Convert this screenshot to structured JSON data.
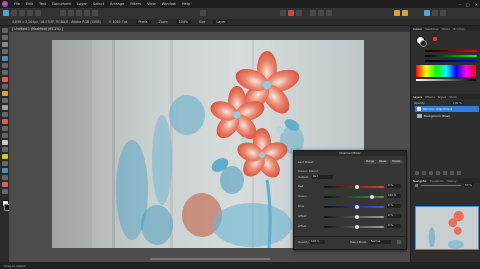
{
  "menu": {
    "items": [
      "File",
      "Edit",
      "Text",
      "Document",
      "Layer",
      "Select",
      "Arrange",
      "Filters",
      "View",
      "Window",
      "Help"
    ]
  },
  "window_controls": {
    "minimize": "–",
    "maximize": "□",
    "close": "✕"
  },
  "context_bar": {
    "info": "4,896 x 3,264px, 16.07MP, RGBA/8 - Adobe RGB (1998)",
    "cursor": "Y: 4069.7px",
    "units": "Pixels",
    "zoom_label": "Zoom",
    "zoom_value": "104%",
    "sample": "Size",
    "blend": "Layer"
  },
  "document": {
    "tab_title": "[ Untitled 1 (Modified) (85.2%) ]"
  },
  "right_panel": {
    "tabs_top": [
      "Colour",
      "Swatches",
      "Stroke",
      "Brushes"
    ],
    "tabs_mid": [
      "Layers",
      "Effects",
      "Styles",
      "Stock"
    ],
    "blend_label": "Opacity",
    "blend_value": "100 %",
    "layers": [
      {
        "name": "Recolour Adjustment",
        "type": "adjustment",
        "selected": true
      },
      {
        "name": "Background (Pixel)",
        "type": "pixel",
        "selected": false
      }
    ],
    "tabs_bottom": [
      "Navigator",
      "Transform",
      "History"
    ],
    "zoom_value": "83 %"
  },
  "dialog": {
    "title": "Channel Mixer",
    "preset_label": "Last Preset",
    "buttons": [
      "Merge",
      "Reset",
      "Delete"
    ],
    "colour_label": "Colour: Colour",
    "output_label": "Output",
    "output_value": "Red",
    "rows": [
      {
        "label": "Red",
        "value": "0 %",
        "color": "#d84040",
        "pos": 0.52
      },
      {
        "label": "Green",
        "value": "100 %",
        "color": "#40a040",
        "pos": 0.76
      },
      {
        "label": "Blue",
        "value": "0 %",
        "color": "#3c5ad8",
        "pos": 0.52
      },
      {
        "label": "Offset",
        "value": "0 %",
        "color": "#9a9a9a",
        "pos": 0.52
      },
      {
        "label": "Offset",
        "value": "0 %",
        "color": "#9a9a9a",
        "pos": 0.52
      }
    ],
    "opacity_label": "Opacity",
    "opacity_value": "100 %",
    "blend_label": "Blend Mode",
    "blend_value": "Normal"
  },
  "status": {
    "text": "Drag to select."
  },
  "colors": {
    "accent": "#3a7bd5",
    "photo_bg": "#c9d3d4",
    "flower": "#e8705a",
    "leaf": "#4fa8cc"
  }
}
